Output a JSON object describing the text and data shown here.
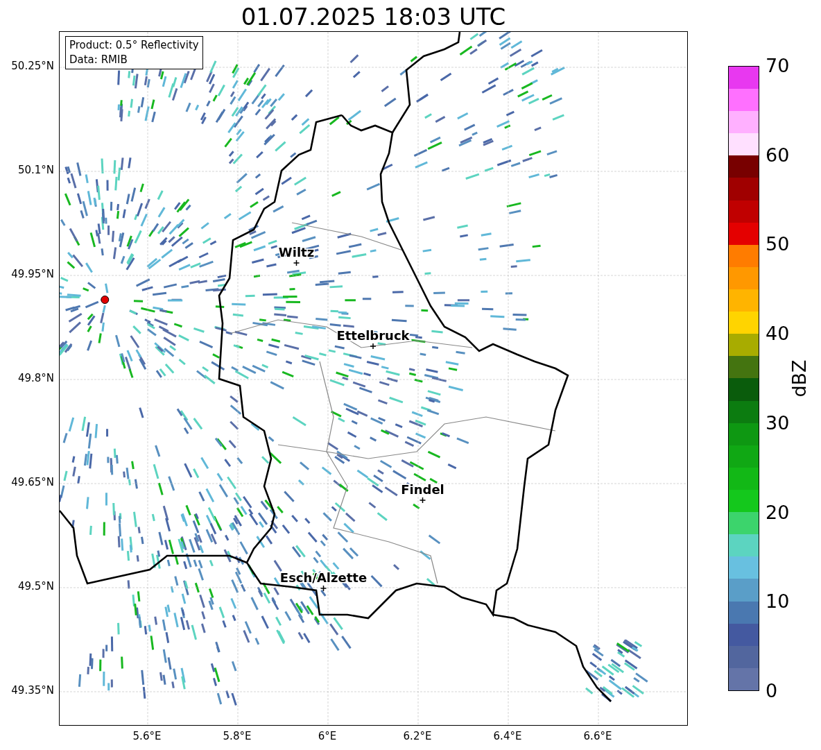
{
  "title": "01.07.2025 18:03 UTC",
  "info_box": [
    "Product: 0.5° Reflectivity",
    "Data: RMIB"
  ],
  "x_ticks": [
    "5.6°E",
    "5.8°E",
    "6°E",
    "6.2°E",
    "6.4°E",
    "6.6°E"
  ],
  "y_ticks": [
    "50.25°N",
    "50.1°N",
    "49.95°N",
    "49.8°N",
    "49.65°N",
    "49.5°N",
    "49.35°N"
  ],
  "cities": [
    {
      "name": "Wiltz"
    },
    {
      "name": "Ettelbruck"
    },
    {
      "name": "Findel"
    },
    {
      "name": "Esch/Alzette"
    }
  ],
  "colorbar": {
    "label": "dBZ",
    "ticks": [
      "70",
      "60",
      "50",
      "40",
      "30",
      "20",
      "10",
      "0"
    ],
    "bins": [
      {
        "color": "#6474a8"
      },
      {
        "color": "#52669e"
      },
      {
        "color": "#4459a0"
      },
      {
        "color": "#4a78b0"
      },
      {
        "color": "#5a9ec8"
      },
      {
        "color": "#68c0e0"
      },
      {
        "color": "#5cd4c0"
      },
      {
        "color": "#3cd46c"
      },
      {
        "color": "#14c81c"
      },
      {
        "color": "#12b816"
      },
      {
        "color": "#10a814"
      },
      {
        "color": "#0e9812"
      },
      {
        "color": "#0c7c10"
      },
      {
        "color": "#0a5c0c"
      },
      {
        "color": "#447410"
      },
      {
        "color": "#a8ac00"
      },
      {
        "color": "#ffd400"
      },
      {
        "color": "#ffb400"
      },
      {
        "color": "#ff9800"
      },
      {
        "color": "#ff7c00"
      },
      {
        "color": "#e40000"
      },
      {
        "color": "#c00000"
      },
      {
        "color": "#a00000"
      },
      {
        "color": "#780000"
      },
      {
        "color": "#ffe0ff"
      },
      {
        "color": "#ffb0ff"
      },
      {
        "color": "#ff70ff"
      },
      {
        "color": "#e838f0"
      }
    ]
  }
}
